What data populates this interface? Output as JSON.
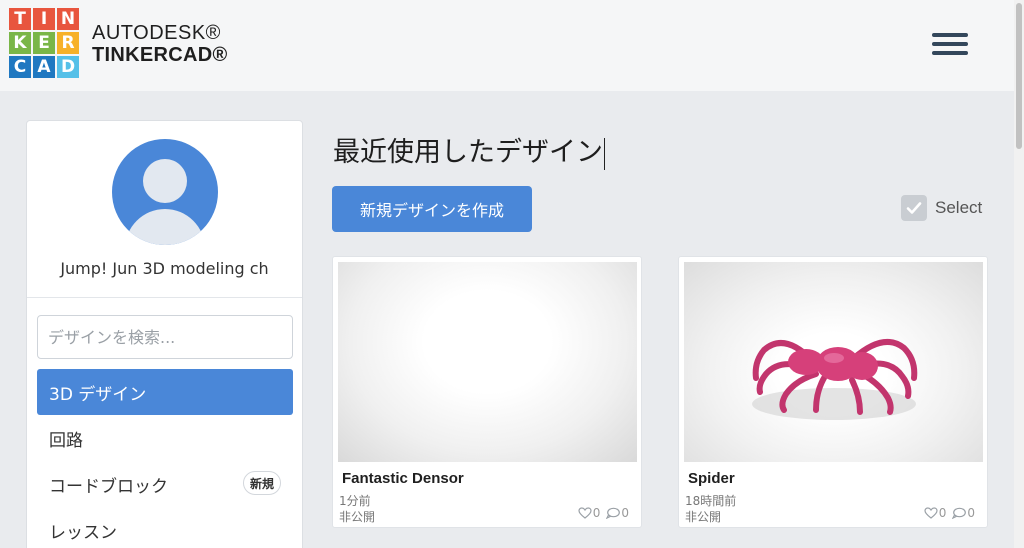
{
  "header": {
    "logo_letters": [
      "T",
      "I",
      "N",
      "K",
      "E",
      "R",
      "C",
      "A",
      "D"
    ],
    "logo_colors": [
      "#e8553e",
      "#e8553e",
      "#e8553e",
      "#7ab648",
      "#7ab648",
      "#f7b128",
      "#1f78c1",
      "#1f78c1",
      "#55c0e8"
    ],
    "brand_line1": "AUTODESK®",
    "brand_line2": "TINKERCAD®",
    "menu_icon": "hamburger-menu-icon"
  },
  "sidebar": {
    "username": "Jump! Jun 3D modeling ch",
    "search_placeholder": "デザインを検索...",
    "nav": [
      {
        "label": "3D デザイン",
        "active": true
      },
      {
        "label": "回路",
        "active": false
      },
      {
        "label": "コードブロック",
        "badge": "新規",
        "active": false
      },
      {
        "label": "レッスン",
        "active": false
      }
    ]
  },
  "main": {
    "title": "最近使用したデザイン",
    "create_button": "新規デザインを作成",
    "select_label": "Select",
    "designs": [
      {
        "name": "Fantastic Densor",
        "time": "1分前",
        "visibility": "非公開",
        "likes": "0",
        "comments": "0"
      },
      {
        "name": "Spider",
        "time": "18時間前",
        "visibility": "非公開",
        "likes": "0",
        "comments": "0"
      }
    ]
  },
  "colors": {
    "accent": "#4a87d8",
    "spider": "#d6407a"
  }
}
